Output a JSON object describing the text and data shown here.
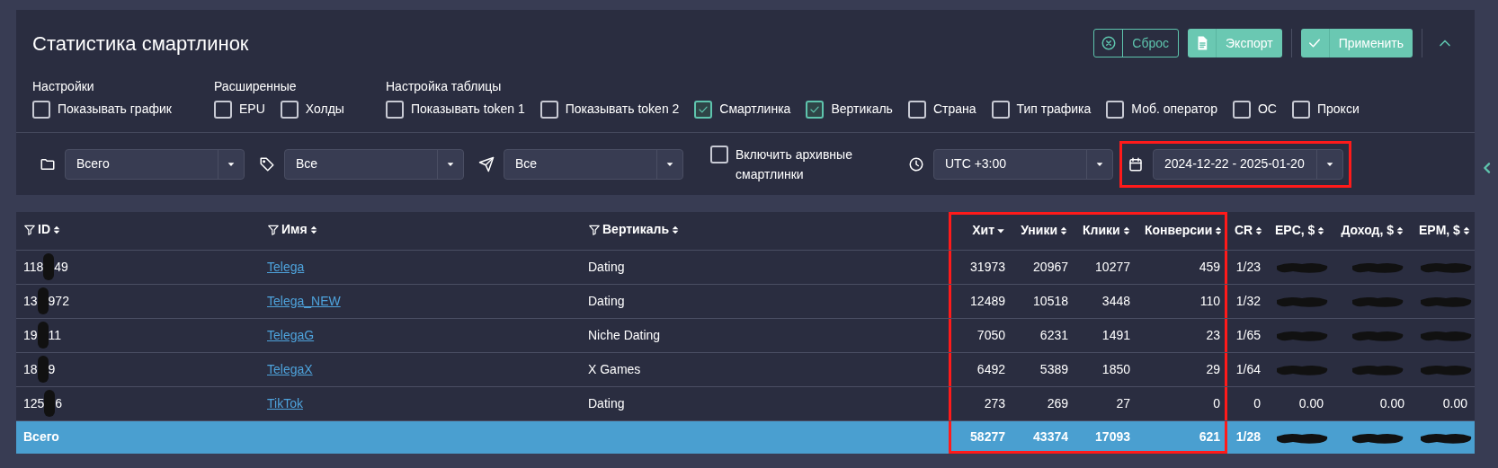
{
  "title": "Статистика смартлинок",
  "actions": [
    {
      "kind": "reset",
      "label": "Сброс"
    },
    {
      "kind": "export",
      "label": "Экспорт"
    },
    {
      "kind": "apply",
      "label": "Применить"
    }
  ],
  "collapse": {
    "expanded": true
  },
  "option_groups": [
    {
      "title": "Настройки",
      "options": [
        {
          "label": "Показывать график",
          "checked": false
        }
      ]
    },
    {
      "title": "Расширенные",
      "options": [
        {
          "label": "EPU",
          "checked": false
        },
        {
          "label": "Холды",
          "checked": false
        }
      ]
    },
    {
      "title": "Настройка таблицы",
      "options": [
        {
          "label": "Показывать token 1",
          "checked": false
        },
        {
          "label": "Показывать token 2",
          "checked": false
        },
        {
          "label": "Смартлинка",
          "checked": true
        },
        {
          "label": "Вертикаль",
          "checked": true
        },
        {
          "label": "Страна",
          "checked": false
        },
        {
          "label": "Тип трафика",
          "checked": false
        },
        {
          "label": "Моб. оператор",
          "checked": false
        },
        {
          "label": "ОС",
          "checked": false
        },
        {
          "label": "Прокси",
          "checked": false
        }
      ]
    }
  ],
  "filters": [
    {
      "kind": "folder",
      "value": "Всего"
    },
    {
      "kind": "tag",
      "value": "Все"
    },
    {
      "kind": "send",
      "value": "Все"
    }
  ],
  "archive": {
    "label": "Включить архивные смартлинки",
    "checked": false
  },
  "timezone": {
    "value": "UTC +3:00"
  },
  "date_range": {
    "value": "2024-12-22 - 2025-01-20",
    "highlighted": true
  },
  "table": {
    "columns": [
      {
        "label": "ID",
        "filter": true,
        "sorted": false,
        "highlighted": false
      },
      {
        "label": "Имя",
        "filter": true,
        "sorted": false,
        "highlighted": false
      },
      {
        "label": "Вертикаль",
        "filter": true,
        "sorted": false,
        "highlighted": false
      },
      {
        "label": "Хит",
        "filter": false,
        "sorted": true,
        "highlighted": true
      },
      {
        "label": "Уники",
        "filter": false,
        "sorted": false,
        "highlighted": true
      },
      {
        "label": "Клики",
        "filter": false,
        "sorted": false,
        "highlighted": true
      },
      {
        "label": "Конверсии",
        "filter": false,
        "sorted": false,
        "highlighted": true
      },
      {
        "label": "CR",
        "filter": false,
        "sorted": false,
        "highlighted": false
      },
      {
        "label": "EPC, $",
        "filter": false,
        "sorted": false,
        "highlighted": false
      },
      {
        "label": "Доход, $",
        "filter": false,
        "sorted": false,
        "highlighted": false
      },
      {
        "label": "EPM, $",
        "filter": false,
        "sorted": false,
        "highlighted": false
      }
    ],
    "rows": [
      {
        "total": false,
        "cells": [
          {
            "kind": "redacted",
            "parts": [
              "118",
              "49"
            ]
          },
          {
            "kind": "link",
            "text": "Telega"
          },
          {
            "kind": "text",
            "text": "Dating"
          },
          {
            "kind": "text",
            "text": "31973"
          },
          {
            "kind": "text",
            "text": "20967"
          },
          {
            "kind": "text",
            "text": "10277"
          },
          {
            "kind": "text",
            "text": "459"
          },
          {
            "kind": "text",
            "text": "1/23"
          },
          {
            "kind": "hidden"
          },
          {
            "kind": "hidden"
          },
          {
            "kind": "hidden"
          }
        ]
      },
      {
        "total": false,
        "cells": [
          {
            "kind": "redacted",
            "parts": [
              "13",
              "972"
            ]
          },
          {
            "kind": "link",
            "text": "Telega_NEW"
          },
          {
            "kind": "text",
            "text": "Dating"
          },
          {
            "kind": "text",
            "text": "12489"
          },
          {
            "kind": "text",
            "text": "10518"
          },
          {
            "kind": "text",
            "text": "3448"
          },
          {
            "kind": "text",
            "text": "110"
          },
          {
            "kind": "text",
            "text": "1/32"
          },
          {
            "kind": "hidden"
          },
          {
            "kind": "hidden"
          },
          {
            "kind": "hidden"
          }
        ]
      },
      {
        "total": false,
        "cells": [
          {
            "kind": "redacted",
            "parts": [
              "19",
              "11"
            ]
          },
          {
            "kind": "link",
            "text": "TelegaG"
          },
          {
            "kind": "text",
            "text": "Niche Dating"
          },
          {
            "kind": "text",
            "text": "7050"
          },
          {
            "kind": "text",
            "text": "6231"
          },
          {
            "kind": "text",
            "text": "1491"
          },
          {
            "kind": "text",
            "text": "23"
          },
          {
            "kind": "text",
            "text": "1/65"
          },
          {
            "kind": "hidden"
          },
          {
            "kind": "hidden"
          },
          {
            "kind": "hidden"
          }
        ]
      },
      {
        "total": false,
        "cells": [
          {
            "kind": "redacted",
            "parts": [
              "18",
              "9"
            ]
          },
          {
            "kind": "link",
            "text": "TelegaX"
          },
          {
            "kind": "text",
            "text": "X Games"
          },
          {
            "kind": "text",
            "text": "6492"
          },
          {
            "kind": "text",
            "text": "5389"
          },
          {
            "kind": "text",
            "text": "1850"
          },
          {
            "kind": "text",
            "text": "29"
          },
          {
            "kind": "text",
            "text": "1/64"
          },
          {
            "kind": "hidden"
          },
          {
            "kind": "hidden"
          },
          {
            "kind": "hidden"
          }
        ]
      },
      {
        "total": false,
        "cells": [
          {
            "kind": "redacted",
            "parts": [
              "125",
              "6"
            ]
          },
          {
            "kind": "link",
            "text": "TikTok"
          },
          {
            "kind": "text",
            "text": "Dating"
          },
          {
            "kind": "text",
            "text": "273"
          },
          {
            "kind": "text",
            "text": "269"
          },
          {
            "kind": "text",
            "text": "27"
          },
          {
            "kind": "text",
            "text": "0"
          },
          {
            "kind": "text",
            "text": "0"
          },
          {
            "kind": "text",
            "text": "0.00"
          },
          {
            "kind": "text",
            "text": "0.00"
          },
          {
            "kind": "text",
            "text": "0.00"
          }
        ]
      },
      {
        "total": true,
        "cells": [
          {
            "kind": "text",
            "text": "Всего"
          },
          {
            "kind": "empty"
          },
          {
            "kind": "empty"
          },
          {
            "kind": "text",
            "text": "58277"
          },
          {
            "kind": "text",
            "text": "43374"
          },
          {
            "kind": "text",
            "text": "17093"
          },
          {
            "kind": "text",
            "text": "621"
          },
          {
            "kind": "text",
            "text": "1/28"
          },
          {
            "kind": "hidden"
          },
          {
            "kind": "hidden"
          },
          {
            "kind": "hidden"
          }
        ]
      }
    ]
  }
}
